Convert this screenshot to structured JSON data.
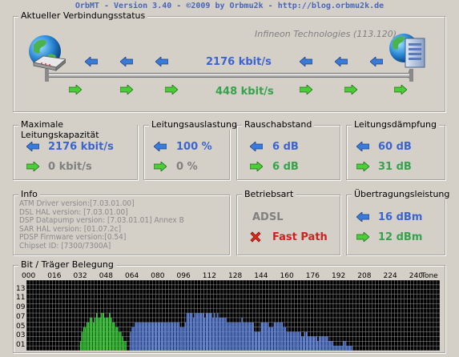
{
  "window": {
    "title": "OrbMT - Version 3.40 - ©2009 by Orbmu2k - http://blog.orbmu2k.de"
  },
  "connection": {
    "legend": "Aktueller Verbindungsstatus",
    "chipset_label": "Infineon Technologies (113.120)",
    "downstream": "2176 kbit/s",
    "upstream": "448 kbit/s"
  },
  "capacity": {
    "legend": "Maximale Leitungskapazität",
    "down": "2176 kbit/s",
    "up": "0 kbit/s"
  },
  "utilization": {
    "legend": "Leitungsauslastung",
    "down": "100 %",
    "up": "0 %"
  },
  "snr": {
    "legend": "Rauschabstand",
    "down": "6 dB",
    "up": "6 dB"
  },
  "attenuation": {
    "legend": "Leitungsdämpfung",
    "down": "60 dB",
    "up": "31 dB"
  },
  "info": {
    "legend": "Info",
    "lines": [
      "ATM Driver version:[7.03.01.00]",
      "DSL HAL version: [7.03.01.00]",
      "DSP Datapump version: [7.03.01.01] Annex B",
      "SAR HAL version: [01.07.2c]",
      "PDSP Firmware version:[0.54]",
      "Chipset ID: [7300/7300A]"
    ]
  },
  "operating_mode": {
    "legend": "Betriebsart",
    "mode": "ADSL",
    "path": "Fast Path"
  },
  "power": {
    "legend": "Übertragungsleistung",
    "down": "16 dBm",
    "up": "12 dBm"
  },
  "bitloading": {
    "legend": "Bit / Träger Belegung",
    "x_ticks": [
      "000",
      "016",
      "032",
      "048",
      "064",
      "080",
      "096",
      "112",
      "128",
      "144",
      "160",
      "176",
      "192",
      "208",
      "224",
      "240"
    ],
    "x_label": "Tone",
    "y_ticks": [
      "13",
      "11",
      "09",
      "07",
      "05",
      "03",
      "01"
    ],
    "colors": {
      "upstream": "#33cc33",
      "downstream": "#5b82e0",
      "background": "#000000",
      "grid": "#9a9a9a"
    }
  },
  "chart_data": {
    "type": "bar",
    "xlabel": "Tone",
    "ylabel": "",
    "xlim": [
      0,
      255
    ],
    "ylim": [
      0,
      15
    ],
    "series": [
      {
        "name": "",
        "x_start": 33,
        "values": [
          2,
          4,
          5,
          5,
          6,
          6,
          7,
          7,
          6,
          7,
          8,
          7,
          7,
          8,
          8,
          7,
          7,
          7,
          8,
          7,
          6,
          6,
          5,
          5,
          4,
          4,
          3,
          2,
          2
        ]
      },
      {
        "name": "",
        "x_start": 64,
        "values": [
          4,
          5,
          5,
          6,
          6,
          6,
          6,
          6,
          6,
          6,
          6,
          6,
          6,
          6,
          6,
          6,
          6,
          6,
          6,
          6,
          6,
          6,
          6,
          6,
          6,
          6,
          6,
          6,
          6,
          6,
          6,
          5,
          5,
          5,
          6,
          8,
          8,
          8,
          8,
          7,
          8,
          8,
          8,
          8,
          8,
          8,
          7,
          8,
          8,
          8,
          8,
          7,
          8,
          7,
          8,
          7,
          7,
          7,
          7,
          7,
          6,
          6,
          6,
          6,
          6,
          6,
          6,
          6,
          6,
          7,
          6,
          6,
          6,
          6,
          6,
          6,
          6,
          4,
          4,
          4,
          4,
          6,
          6,
          6,
          6,
          6,
          5,
          5,
          5,
          6,
          6,
          6,
          6,
          6,
          6,
          5,
          5,
          4,
          4,
          4,
          4,
          4,
          4,
          4,
          4,
          4,
          3,
          3,
          4,
          4,
          3,
          3,
          3,
          3,
          3,
          3,
          2,
          3,
          3,
          3,
          3,
          3,
          3,
          2,
          2,
          2,
          1,
          1,
          1,
          1,
          1,
          1,
          2,
          2,
          1,
          1,
          1,
          1
        ]
      }
    ]
  }
}
